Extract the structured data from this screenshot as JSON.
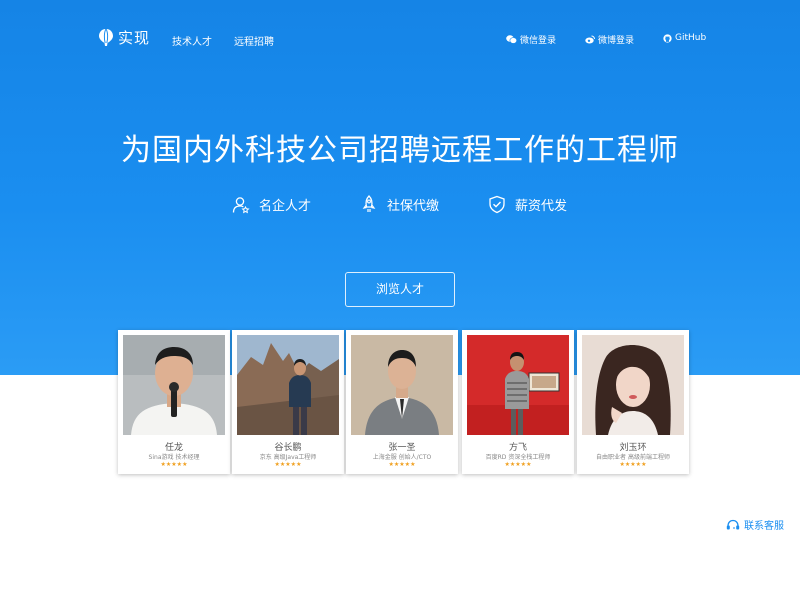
{
  "header": {
    "logo_text": "实现",
    "nav": [
      "技术人才",
      "远程招聘"
    ],
    "logins": [
      {
        "label": "微信登录",
        "icon": "wechat-icon"
      },
      {
        "label": "微博登录",
        "icon": "weibo-icon"
      },
      {
        "label": "GitHub",
        "icon": "github-icon"
      }
    ]
  },
  "hero": {
    "headline": "为国内外科技公司招聘远程工作的工程师",
    "features": [
      {
        "label": "名企人才",
        "icon": "user-star-icon"
      },
      {
        "label": "社保代缴",
        "icon": "rocket-icon"
      },
      {
        "label": "薪资代发",
        "icon": "shield-check-icon"
      }
    ],
    "browse_button": "浏览人才"
  },
  "talents": [
    {
      "name": "任龙",
      "company": "Sina游戏",
      "title": "技术经理",
      "stars": "★★★★★"
    },
    {
      "name": "谷长鹏",
      "company": "京东",
      "title": "高级Java工程师",
      "stars": "★★★★★"
    },
    {
      "name": "张一圣",
      "company": "上海金服",
      "title": "创始人/CTO",
      "stars": "★★★★★"
    },
    {
      "name": "方飞",
      "company": "百度RD",
      "title": "资深全栈工程师",
      "stars": "★★★★★"
    },
    {
      "name": "刘玉环",
      "company": "自由职业者",
      "title": "高级前端工程师",
      "stars": "★★★★★"
    }
  ],
  "support": {
    "label": "联系客服",
    "icon": "headset-icon"
  },
  "colors": {
    "brand": "#1a8ef0",
    "star": "#f0a020"
  }
}
